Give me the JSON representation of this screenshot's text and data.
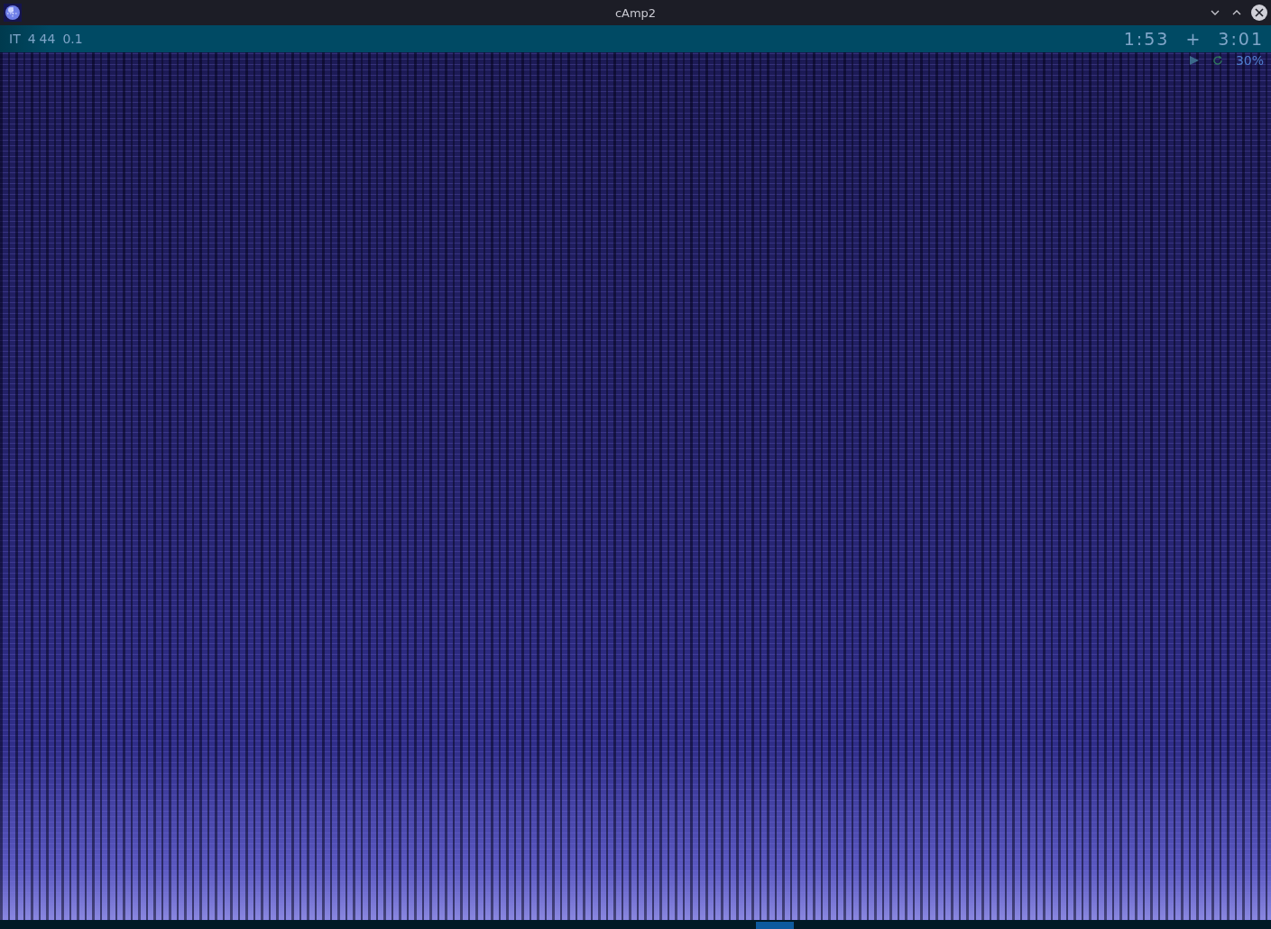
{
  "window": {
    "title": "cAmp2"
  },
  "info_bar": {
    "format": "IT",
    "channels": "4",
    "rate": "44",
    "value": "0.1",
    "position_time": "1:53",
    "separator": "+",
    "total_time": "3:01"
  },
  "overlay": {
    "percent": "30%"
  },
  "seek_bar": {
    "level": 0.61
  }
}
